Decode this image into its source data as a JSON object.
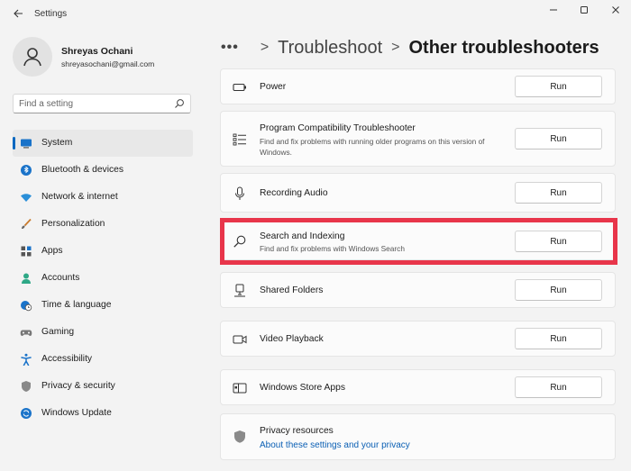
{
  "window": {
    "title": "Settings",
    "controls": [
      "minimize",
      "maximize",
      "close"
    ]
  },
  "profile": {
    "name": "Shreyas Ochani",
    "email": "shreyasochani@gmail.com"
  },
  "search": {
    "placeholder": "Find a setting",
    "value": ""
  },
  "nav": {
    "items": [
      {
        "label": "System",
        "icon": "monitor-icon",
        "active": true
      },
      {
        "label": "Bluetooth & devices",
        "icon": "bluetooth-icon"
      },
      {
        "label": "Network & internet",
        "icon": "wifi-icon"
      },
      {
        "label": "Personalization",
        "icon": "brush-icon"
      },
      {
        "label": "Apps",
        "icon": "apps-icon"
      },
      {
        "label": "Accounts",
        "icon": "person-icon"
      },
      {
        "label": "Time & language",
        "icon": "globe-clock-icon"
      },
      {
        "label": "Gaming",
        "icon": "gamepad-icon"
      },
      {
        "label": "Accessibility",
        "icon": "accessibility-icon"
      },
      {
        "label": "Privacy & security",
        "icon": "shield-icon"
      },
      {
        "label": "Windows Update",
        "icon": "update-icon"
      }
    ]
  },
  "breadcrumb": {
    "more": "•••",
    "separator": ">",
    "parent": "Troubleshoot",
    "current": "Other troubleshooters"
  },
  "troubleshooters": [
    {
      "title": "Power",
      "description": "",
      "icon": "battery-icon",
      "button": "Run"
    },
    {
      "title": "Program Compatibility Troubleshooter",
      "description": "Find and fix problems with running older programs on this version of Windows.",
      "icon": "list-icon",
      "button": "Run"
    },
    {
      "title": "Recording Audio",
      "description": "",
      "icon": "microphone-icon",
      "button": "Run"
    },
    {
      "title": "Search and Indexing",
      "description": "Find and fix problems with Windows Search",
      "icon": "search-icon",
      "button": "Run",
      "highlighted": true
    },
    {
      "title": "Shared Folders",
      "description": "",
      "icon": "network-drive-icon",
      "button": "Run"
    },
    {
      "title": "Video Playback",
      "description": "",
      "icon": "video-camera-icon",
      "button": "Run"
    },
    {
      "title": "Windows Store Apps",
      "description": "",
      "icon": "store-app-icon",
      "button": "Run"
    }
  ],
  "privacy": {
    "title": "Privacy resources",
    "link": "About these settings and your privacy",
    "icon": "shield-icon"
  },
  "colors": {
    "accent": "#0067c0",
    "highlight": "#e8354a",
    "link": "#0a5fb4",
    "background": "#f3f3f3"
  }
}
